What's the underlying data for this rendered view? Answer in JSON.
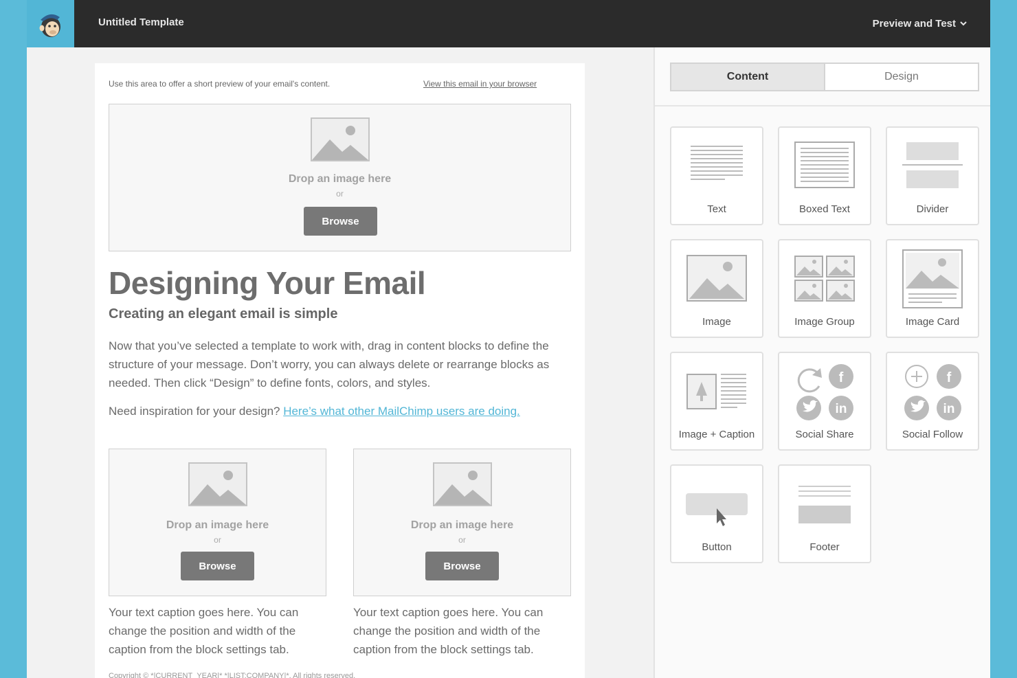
{
  "header": {
    "title": "Untitled Template",
    "preview_label": "Preview and Test"
  },
  "email": {
    "preheader": "Use this area to offer a short preview of your email's content.",
    "view_in_browser": "View this email in your browser",
    "drop_text": "Drop an image here",
    "or_text": "or",
    "browse_label": "Browse",
    "heading": "Designing Your Email",
    "subheading": "Creating an elegant email is simple",
    "body": "Now that you’ve selected a template to work with, drag in content blocks to define the structure of your message. Don’t worry, you can always delete or rearrange blocks as needed. Then click “Design” to define fonts, colors, and styles.",
    "inspiration_prefix": "Need inspiration for your design? ",
    "inspiration_link": "Here’s what other MailChimp users are doing.",
    "caption": "Your text caption goes here. You can change the position and width of the caption from the block settings tab.",
    "copyright": "Copyright © *|CURRENT_YEAR|* *|LIST:COMPANY|*, All rights reserved."
  },
  "panel": {
    "tabs": [
      "Content",
      "Design"
    ],
    "active_tab": "Content",
    "blocks": [
      {
        "label": "Text",
        "icon": "text-block-icon"
      },
      {
        "label": "Boxed Text",
        "icon": "boxed-text-block-icon"
      },
      {
        "label": "Divider",
        "icon": "divider-block-icon"
      },
      {
        "label": "Image",
        "icon": "image-block-icon"
      },
      {
        "label": "Image Group",
        "icon": "image-group-block-icon"
      },
      {
        "label": "Image Card",
        "icon": "image-card-block-icon"
      },
      {
        "label": "Image + Caption",
        "icon": "image-caption-block-icon"
      },
      {
        "label": "Social Share",
        "icon": "social-share-block-icon"
      },
      {
        "label": "Social Follow",
        "icon": "social-follow-block-icon"
      },
      {
        "label": "Button",
        "icon": "button-block-icon"
      },
      {
        "label": "Footer",
        "icon": "footer-block-icon"
      }
    ]
  },
  "colors": {
    "background": "#5bbbd9",
    "topbar": "#2b2b2b",
    "accent": "#52b6d6",
    "button": "#787878"
  }
}
